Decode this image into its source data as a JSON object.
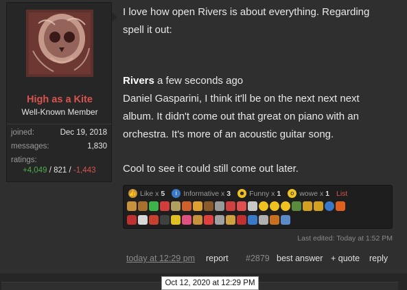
{
  "user": {
    "name": "High as a Kite",
    "title": "Well-Known Member",
    "joined_label": "joined:",
    "joined_value": "Dec 19, 2018",
    "messages_label": "messages:",
    "messages_value": "1,830",
    "ratings_label": "ratings:",
    "ratings_positive": "+4,049",
    "ratings_sep1": " / ",
    "ratings_neutral": "821",
    "ratings_sep2": " / ",
    "ratings_negative": "-1,443"
  },
  "message": {
    "line1": "I love how open Rivers is about everything. Regarding",
    "line2": "spell it out:",
    "quote_author": "Rivers",
    "quote_time": " a few seconds ago",
    "quote_line1": "Daniel Gasparini, I think it'll be on the next next next",
    "quote_line2": "album. It didn't come out that great on piano with an",
    "quote_line3": "orchestra. It's more of an acoustic guitar song.",
    "closing": "Cool to see it could still come out later."
  },
  "reactions": {
    "like_label": "Like x",
    "like_count": "5",
    "informative_label": "Informative x",
    "informative_count": "3",
    "funny_label": "Funny x",
    "funny_count": "1",
    "wowe_label": "wowe x",
    "wowe_count": "1",
    "list_link": "List",
    "colors": [
      "#c8913c",
      "#3a78c8",
      "#f0c020",
      "#f0c020"
    ]
  },
  "footer": {
    "last_edited": "Last edited: Today at 1:52 PM",
    "time": "today at 12:29 pm",
    "report": "report",
    "post_number": "#2879",
    "best_answer": "best answer",
    "quote": "+ quote",
    "reply": "reply"
  },
  "tooltip": "Oct 12, 2020 at 12:29 PM"
}
